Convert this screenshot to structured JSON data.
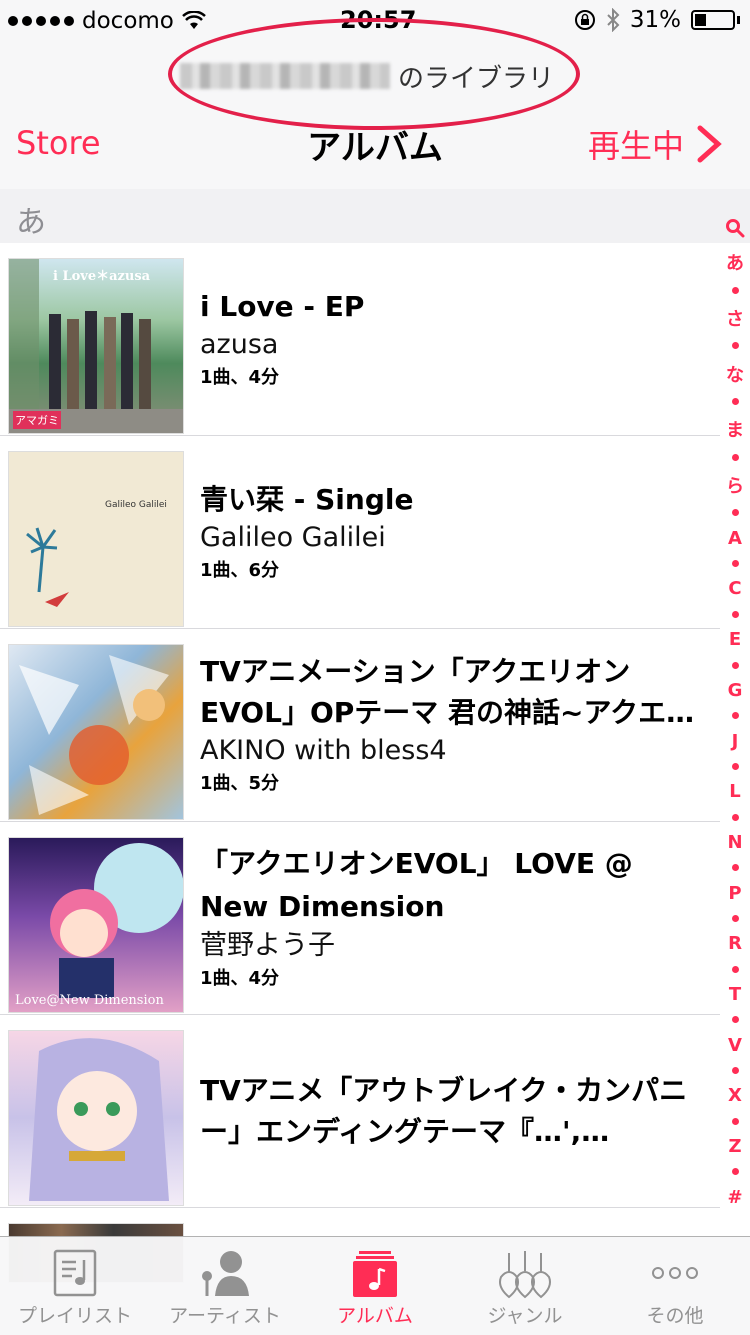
{
  "status_bar": {
    "carrier": "docomo",
    "time": "20:57",
    "battery_percent_label": "31%",
    "battery_level": 0.31
  },
  "header": {
    "library_suffix": "のライブラリ",
    "title": "アルバム",
    "left_button": "Store",
    "right_button": "再生中",
    "accent_color": "#ff2d55"
  },
  "section": {
    "header": "あ"
  },
  "albums": [
    {
      "title": "i Love - EP",
      "artist": "azusa",
      "info": "1曲、4分",
      "art_text": "i Love＊azusa",
      "art_logo": "アマガミ"
    },
    {
      "title": "青い栞 - Single",
      "artist": "Galileo Galilei",
      "info": "1曲、6分",
      "art_text": "Galileo Galilei"
    },
    {
      "title": "TVアニメーション「アクエリオンEVOL」OPテーマ 君の神話~アクエリオン第二章",
      "artist": "AKINO with bless4",
      "info": "1曲、5分"
    },
    {
      "title": "「アクエリオンEVOL」 LOVE @ New Dimension",
      "artist": "菅野よう子",
      "info": "1曲、4分",
      "art_text": "Love@New Dimension"
    },
    {
      "title": "TVアニメ「アウトブレイク・カンパニー」エンディングテーマ『…', 'artist': 'ペトラルカ・アン・エルダント三世', 'info': '1曲、3分'}"
    }
  ],
  "index_bar": [
    "あ",
    "さ",
    "な",
    "ま",
    "ら",
    "A",
    "C",
    "E",
    "G",
    "J",
    "L",
    "N",
    "P",
    "R",
    "T",
    "V",
    "X",
    "Z",
    "#"
  ],
  "tabs": [
    {
      "label": "プレイリスト",
      "icon": "playlist-icon"
    },
    {
      "label": "アーティスト",
      "icon": "artist-icon"
    },
    {
      "label": "アルバム",
      "icon": "album-icon",
      "active": true
    },
    {
      "label": "ジャンル",
      "icon": "genre-icon"
    },
    {
      "label": "その他",
      "icon": "more-icon"
    }
  ]
}
